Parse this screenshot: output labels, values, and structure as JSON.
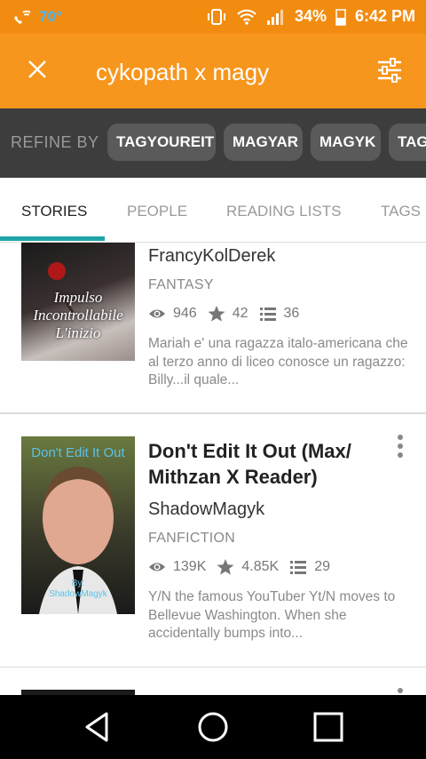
{
  "status": {
    "temp": "70°",
    "battery": "34%",
    "time": "6:42 PM"
  },
  "search": {
    "query": "cykopath x magy"
  },
  "refine": {
    "label": "REFINE BY",
    "chips": [
      "TAGYOUREIT",
      "MAGYAR",
      "MAGYK",
      "TAG"
    ]
  },
  "tabs": [
    "STORIES",
    "PEOPLE",
    "READING LISTS",
    "TAGS"
  ],
  "stories": [
    {
      "cover_text": [
        "Impulso",
        "Incontrollabile",
        "L'inizio"
      ],
      "author": "FrancyKolDerek",
      "genre": "FANTASY",
      "reads": "946",
      "votes": "42",
      "parts": "36",
      "description": "Mariah e' una ragazza  italo-americana che al terzo anno di liceo conosce un ragazzo: Billy...il quale..."
    },
    {
      "cover_text": [
        "Don't Edit It Out",
        "By:",
        "ShadowMagyk"
      ],
      "title": "Don't Edit It Out (Max/ Mithzan X Reader)",
      "author": "ShadowMagyk",
      "genre": "FANFICTION",
      "reads": "139K",
      "votes": "4.85K",
      "parts": "29",
      "description": "Y/N the famous YouTuber  Yt/N moves to Bellevue  Washington. When she accidentally bumps into..."
    }
  ],
  "colors": {
    "status_bar": "#f28c10",
    "app_bar": "#f7961d",
    "refine_bar": "#3d3d3d",
    "tab_indicator": "#20a3a6"
  }
}
